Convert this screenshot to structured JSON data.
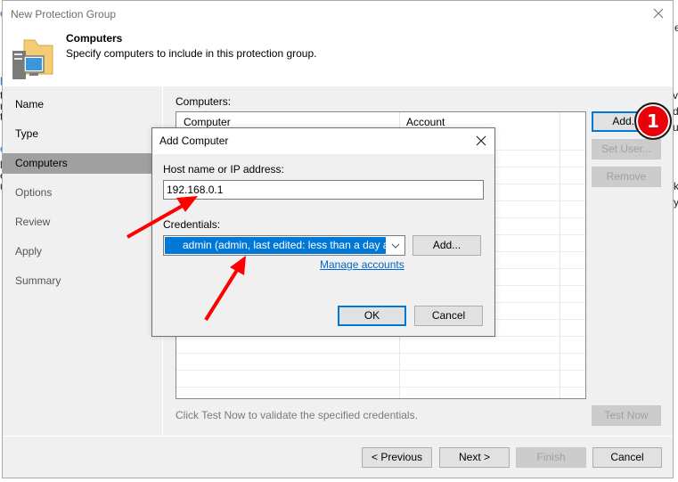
{
  "background": {
    "left_fragments": [
      "e",
      "p",
      "t",
      "r",
      "t",
      "e",
      "l",
      "e",
      "u"
    ],
    "right_fragments": [
      "e",
      "ve",
      "de",
      "ut",
      "k",
      "y"
    ]
  },
  "window": {
    "title": "New Protection Group",
    "close_icon": "close-icon",
    "header": {
      "icon": "computers-folder-icon",
      "title": "Computers",
      "subtitle": "Specify computers to include in this protection group."
    }
  },
  "sidebar": {
    "items": [
      {
        "label": "Name",
        "state": "done"
      },
      {
        "label": "Type",
        "state": "done"
      },
      {
        "label": "Computers",
        "state": "active"
      },
      {
        "label": "Options",
        "state": "pending"
      },
      {
        "label": "Review",
        "state": "pending"
      },
      {
        "label": "Apply",
        "state": "pending"
      },
      {
        "label": "Summary",
        "state": "pending"
      }
    ]
  },
  "content": {
    "computers_label": "Computers:",
    "table": {
      "columns": [
        "Computer",
        "Account"
      ],
      "rows": []
    },
    "buttons": {
      "add": "Add...",
      "set_user": "Set User...",
      "remove": "Remove",
      "test_now": "Test Now"
    },
    "hint": "Click Test Now to validate the specified credentials."
  },
  "footer": {
    "previous": "< Previous",
    "next": "Next >",
    "finish": "Finish",
    "cancel": "Cancel"
  },
  "dialog": {
    "title": "Add Computer",
    "host_label": "Host name or IP address:",
    "host_value": "192.168.0.1",
    "credentials_label": "Credentials:",
    "credentials_value": "admin (admin, last edited: less than a day ago)",
    "credentials_icon": "linux-penguin-icon",
    "add_button": "Add...",
    "manage_accounts_link": "Manage accounts",
    "ok_button": "OK",
    "cancel_button": "Cancel"
  },
  "annotations": {
    "step_badge": "1",
    "accent_color": "#ff0000"
  }
}
